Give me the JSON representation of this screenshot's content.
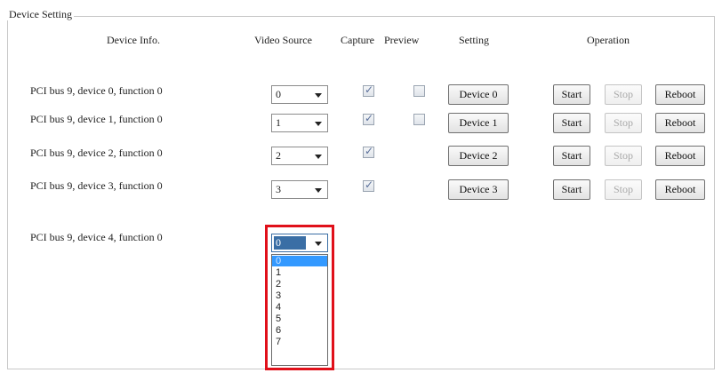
{
  "group": {
    "title": "Device Setting"
  },
  "headers": {
    "device_info": "Device Info.",
    "video_source": "Video Source",
    "capture": "Capture",
    "preview": "Preview",
    "setting": "Setting",
    "operation": "Operation"
  },
  "rows": [
    {
      "label": "PCI bus 9, device 0, function 0",
      "video_source": "0",
      "capture": true,
      "preview": false,
      "setting": "Device 0",
      "start": "Start",
      "stop": "Stop",
      "reboot": "Reboot"
    },
    {
      "label": "PCI bus 9, device 1, function 0",
      "video_source": "1",
      "capture": true,
      "preview": false,
      "setting": "Device 1",
      "start": "Start",
      "stop": "Stop",
      "reboot": "Reboot"
    },
    {
      "label": "PCI bus 9, device 2, function 0",
      "video_source": "2",
      "capture": true,
      "setting": "Device 2",
      "start": "Start",
      "stop": "Stop",
      "reboot": "Reboot"
    },
    {
      "label": "PCI bus 9, device 3, function 0",
      "video_source": "3",
      "capture": true,
      "setting": "Device 3",
      "start": "Start",
      "stop": "Stop",
      "reboot": "Reboot"
    },
    {
      "label": "PCI bus 9, device 4, function 0",
      "video_source": "0"
    }
  ],
  "dropdown": {
    "options": [
      "0",
      "1",
      "2",
      "3",
      "4",
      "5",
      "6",
      "7"
    ],
    "selected": "0"
  },
  "colors": {
    "highlight": "#e0101a",
    "selection": "#3399ff",
    "check": "#5a6f9a"
  },
  "icons": {
    "combo_arrow": "triangle-down",
    "check_mark": "✓"
  }
}
